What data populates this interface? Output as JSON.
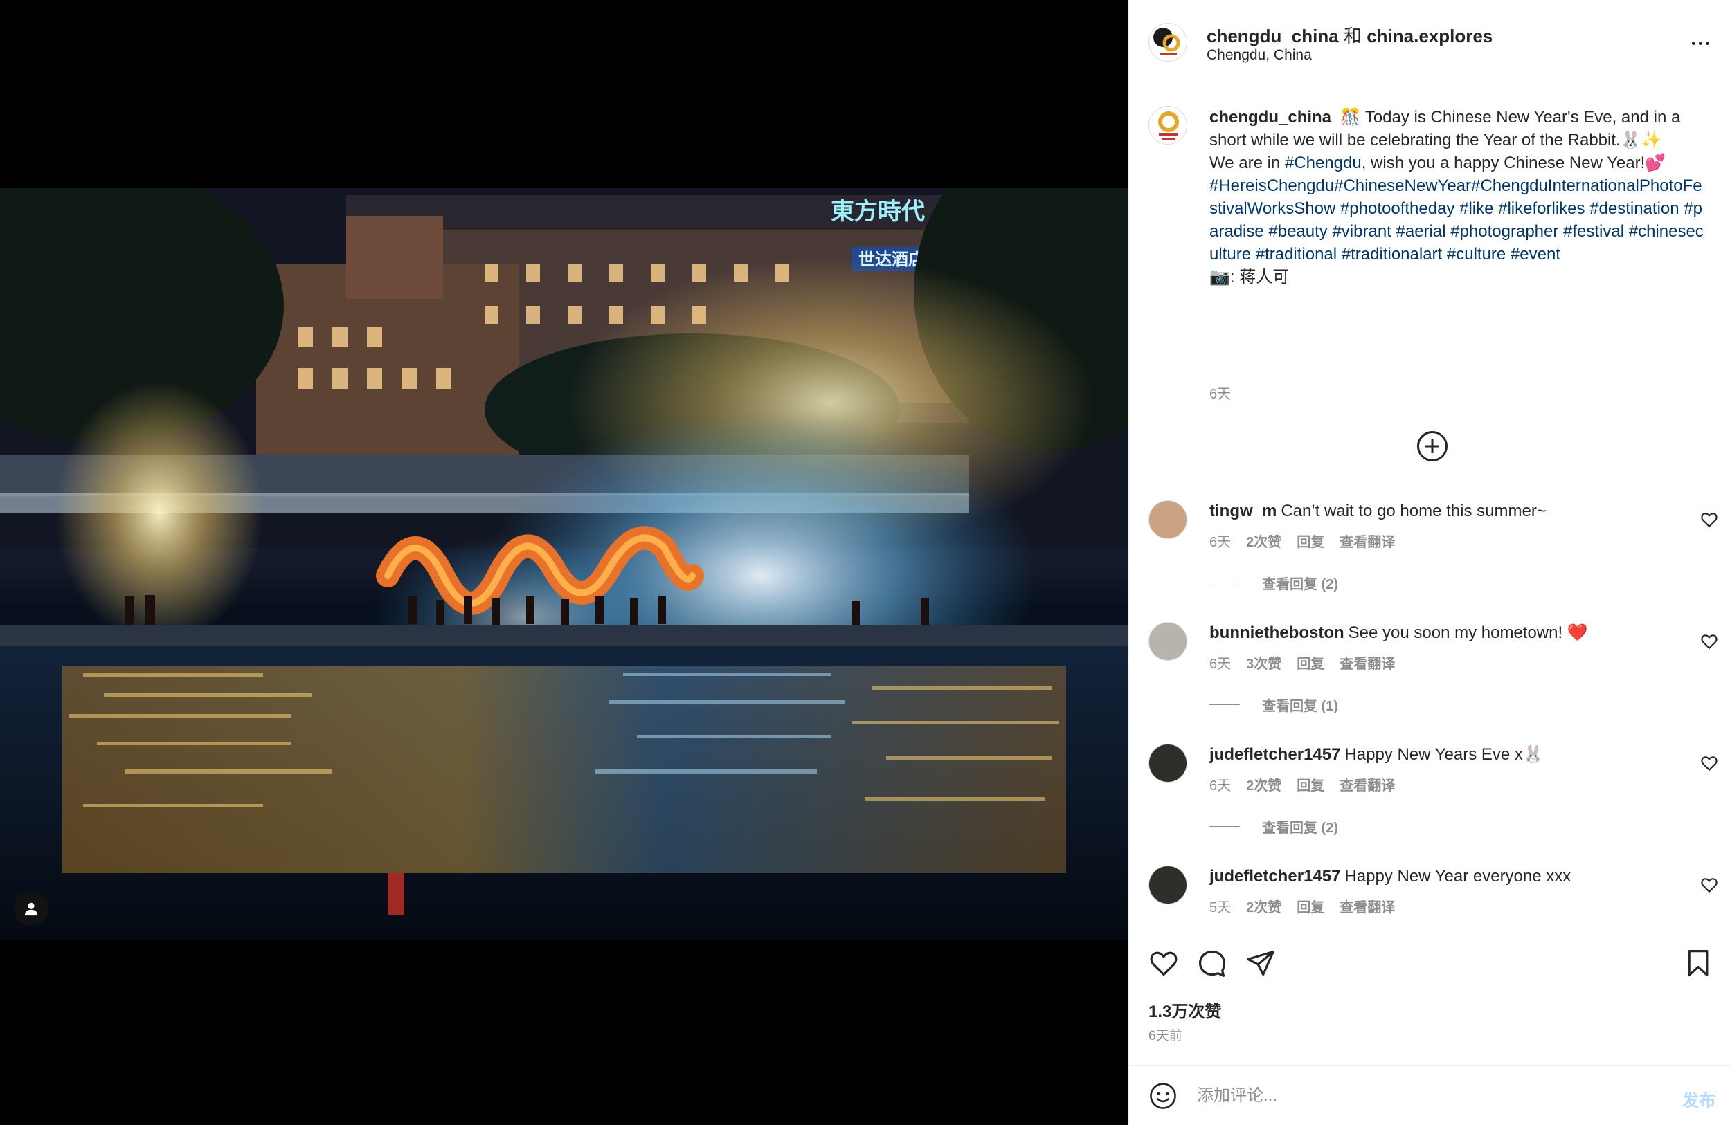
{
  "post": {
    "author": "chengdu_china",
    "joiner": "和",
    "collaborator": "china.explores",
    "location": "Chengdu, China",
    "caption_author": "chengdu_china",
    "caption_line1": "🎊 Today is Chinese New Year's Eve, and in a short while we will be celebrating the Year of the Rabbit.🐰✨",
    "caption_line2_pre": "We are in ",
    "caption_line2_tag": "#Chengdu",
    "caption_line2_post": ", wish you a happy Chinese New Year!💕",
    "hashtags": "#HereisChengdu#ChineseNewYear#ChengduInternationalPhotoFestivalWorksShow #photooftheday #like #likeforlikes #destination #paradise #beauty #vibrant #aerial #photographer #festival #chineseculture #traditional #traditionalart #culture #event",
    "credit": "📷: 蒋人可",
    "caption_time": "6天"
  },
  "comments": [
    {
      "user": "tingw_m",
      "text": "Can’t wait to go home this summer~",
      "time": "6天",
      "likes": "2次赞",
      "reply": "回复",
      "translate": "查看翻译",
      "view_replies": "查看回复 (2)",
      "avatar_color": "#c9a383"
    },
    {
      "user": "bunnietheboston",
      "text": "See you soon my hometown! ❤️",
      "time": "6天",
      "likes": "3次赞",
      "reply": "回复",
      "translate": "查看翻译",
      "view_replies": "查看回复 (1)",
      "avatar_color": "#b9b3ad"
    },
    {
      "user": "judefletcher1457",
      "text": "Happy New Years Eve x🐰",
      "time": "6天",
      "likes": "2次赞",
      "reply": "回复",
      "translate": "查看翻译",
      "view_replies": "查看回复 (2)",
      "avatar_color": "#2f2f2a"
    },
    {
      "user": "judefletcher1457",
      "text": "Happy New Year everyone xxx",
      "time": "5天",
      "likes": "2次赞",
      "reply": "回复",
      "translate": "查看翻译",
      "view_replies": "",
      "avatar_color": "#2f2f2a"
    }
  ],
  "engagement": {
    "likes": "1.3万次赞",
    "time": "6天前"
  },
  "composer": {
    "placeholder": "添加评论...",
    "post_label": "发布"
  },
  "photo_signs": {
    "sign1": "東方時代",
    "sign2": "世达酒店"
  },
  "icons": {
    "like": "heart-icon",
    "comment": "comment-bubble-icon",
    "share": "paper-plane-icon",
    "save": "bookmark-icon",
    "emoji": "smiley-icon",
    "more": "more-dots-icon",
    "tagged_users": "user-icon",
    "load_more": "plus-circle-icon"
  }
}
